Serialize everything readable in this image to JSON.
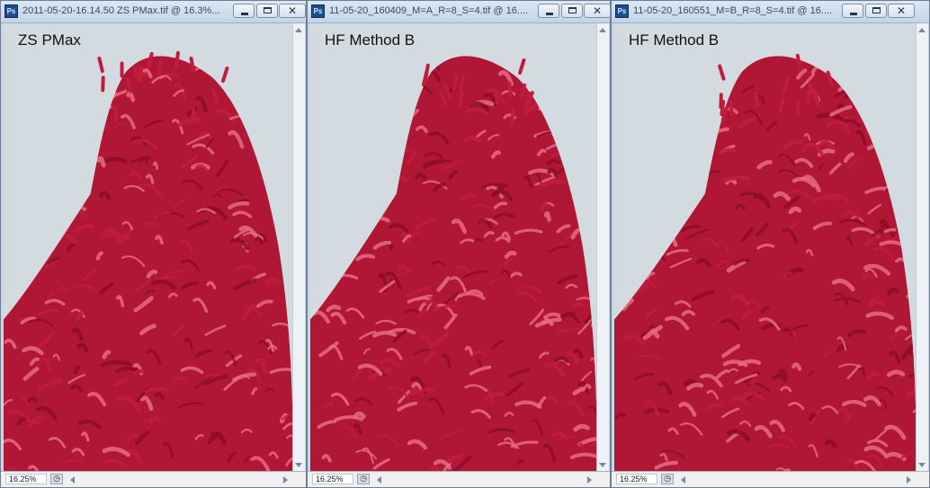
{
  "colors": {
    "specimen_dark": "#8d0d26",
    "specimen_mid": "#c21c3c",
    "specimen_light": "#e86a86",
    "stem": "#c7752c",
    "background_cool": "#d3dbe0",
    "titlebar": "#c4d4e8"
  },
  "windows": [
    {
      "app_icon": "photoshop-icon",
      "app_icon_glyph": "Ps",
      "title": "2011-05-20-16.14.50 ZS PMax.tif @ 16.3%...",
      "overlay_label": "ZS PMax",
      "zoom": "16.25%",
      "status_glyph": "◷"
    },
    {
      "app_icon": "photoshop-icon",
      "app_icon_glyph": "Ps",
      "title": "11-05-20_160409_M=A_R=8_S=4.tif @ 16....",
      "overlay_label": "HF Method B",
      "zoom": "16.25%",
      "status_glyph": "◷"
    },
    {
      "app_icon": "photoshop-icon",
      "app_icon_glyph": "Ps",
      "title": "11-05-20_160551_M=B_R=8_S=4.tif @ 16....",
      "overlay_label": "HF Method B",
      "zoom": "16.25%",
      "status_glyph": "◷"
    }
  ],
  "controls": {
    "close_glyph": "✕"
  }
}
